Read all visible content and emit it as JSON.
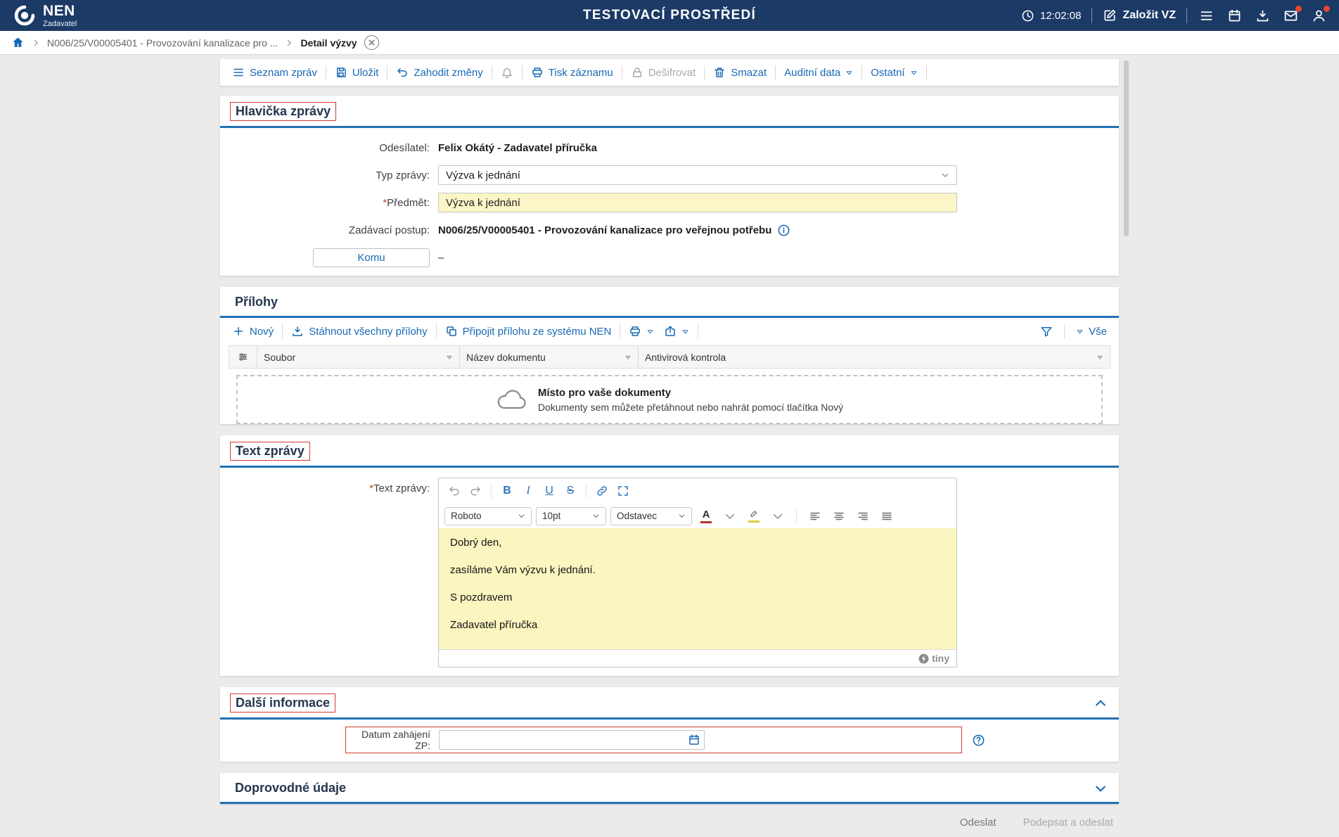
{
  "topbar": {
    "brand": "NEN",
    "brand_sub": "Zadavatel",
    "env_title": "TESTOVACÍ PROSTŘEDÍ",
    "time": "12:02:08",
    "new_vz_label": "Založit VZ"
  },
  "breadcrumb": {
    "procedure": "N006/25/V00005401 - Provozování kanalizace pro ...",
    "current": "Detail výzvy"
  },
  "toolbar": {
    "list_label": "Seznam zpráv",
    "save_label": "Uložit",
    "discard_label": "Zahodit změny",
    "print_label": "Tisk záznamu",
    "decrypt_label": "Dešifrovat",
    "delete_label": "Smazat",
    "audit_label": "Auditní data",
    "other_label": "Ostatní"
  },
  "message_header": {
    "title": "Hlavička zprávy",
    "sender_label": "Odesílatel:",
    "sender_value": "Felix Okátý - Zadavatel příručka",
    "type_label": "Typ zprávy:",
    "type_value": "Výzva k jednání",
    "subject_required": "*",
    "subject_label": "Předmět:",
    "subject_value": "Výzva k jednání",
    "procedure_label": "Zadávací postup:",
    "procedure_value": "N006/25/V00005401 - Provozování kanalizace pro veřejnou potřebu",
    "recipients_button": "Komu",
    "recipients_value": "–"
  },
  "attachments": {
    "title": "Přílohy",
    "new_label": "Nový",
    "download_all_label": "Stáhnout všechny přílohy",
    "attach_from_nen_label": "Připojit přílohu ze systému NEN",
    "all_label": "Vše",
    "columns": [
      "Soubor",
      "Název dokumentu",
      "Antivirová kontrola"
    ],
    "dropzone_title": "Místo pro vaše dokumenty",
    "dropzone_subtitle": "Dokumenty sem můžete přetáhnout nebo nahrát pomocí tlačítka Nový"
  },
  "message_body": {
    "title": "Text zprávy",
    "field_required": "*",
    "field_label": "Text zprávy:",
    "editor": {
      "font_name": "Roboto",
      "font_size": "10pt",
      "block_format": "Odstavec",
      "paragraphs": [
        "Dobrý den,",
        "zasíláme Vám výzvu k jednání.",
        "S pozdravem",
        "Zadavatel příručka"
      ],
      "brand": "tiny"
    }
  },
  "additional_info": {
    "title": "Další informace",
    "start_date_label": "Datum zahájení ZP:",
    "start_date_value": ""
  },
  "accompanying_data": {
    "title": "Doprovodné údaje"
  },
  "footer": {
    "send_label": "Odeslat",
    "sign_send_label": "Podepsat a odeslat"
  }
}
